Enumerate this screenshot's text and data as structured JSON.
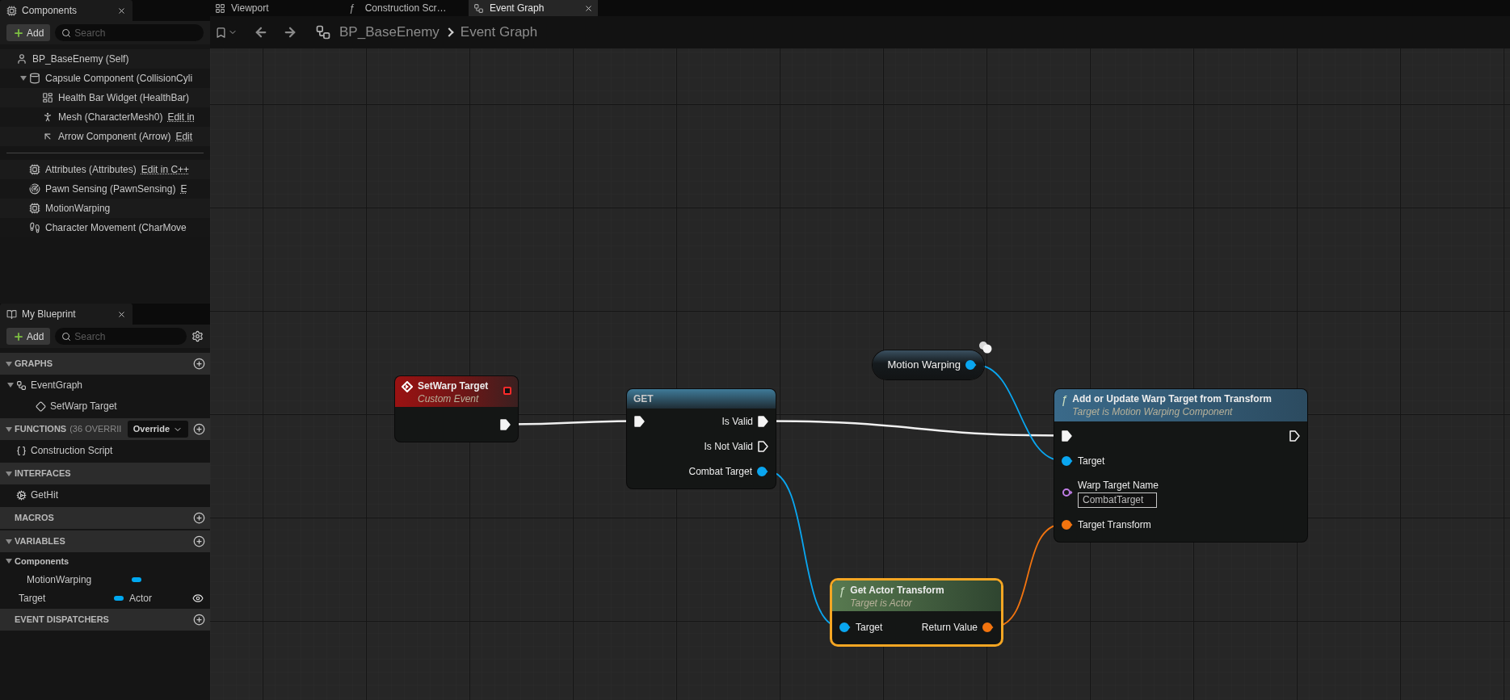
{
  "components_panel": {
    "tab": "Components",
    "add_label": "Add",
    "search_placeholder": "Search",
    "tree": [
      {
        "label": "BP_BaseEnemy (Self)",
        "children": [
          {
            "label": "Capsule Component (CollisionCyli",
            "expanded": true,
            "children": [
              {
                "label": "Health Bar Widget (HealthBar)"
              },
              {
                "label": "Mesh (CharacterMesh0)",
                "link": "Edit in"
              },
              {
                "label": "Arrow Component (Arrow)",
                "link": "Edit"
              }
            ]
          }
        ]
      }
    ],
    "native_components": [
      {
        "label": "Attributes (Attributes)",
        "link": "Edit in C++"
      },
      {
        "label": "Pawn Sensing (PawnSensing)",
        "link": "E"
      },
      {
        "label": "MotionWarping"
      },
      {
        "label": "Character Movement (CharMove"
      }
    ]
  },
  "my_blueprint": {
    "tab": "My Blueprint",
    "add_label": "Add",
    "search_placeholder": "Search",
    "sections": [
      {
        "kind": "graphs",
        "title": "GRAPHS",
        "expanded": true,
        "add": true,
        "items": [
          {
            "label": "EventGraph",
            "expanded": true,
            "children": [
              {
                "label": "SetWarp Target"
              }
            ]
          }
        ]
      },
      {
        "kind": "functions",
        "title": "FUNCTIONS",
        "note": "(36 OVERRII",
        "dropdown": "Override",
        "expanded": true,
        "add": true,
        "items": [
          {
            "label": "Construction Script"
          }
        ]
      },
      {
        "kind": "interfaces",
        "title": "INTERFACES",
        "expanded": true,
        "add": false,
        "items": [
          {
            "label": "GetHit"
          }
        ]
      },
      {
        "title": "MACROS",
        "add": true
      },
      {
        "title": "VARIABLES",
        "expanded": true,
        "add": true,
        "categories": [
          {
            "label": "Components",
            "expanded": true,
            "variables": [
              {
                "name": "MotionWarping"
              }
            ]
          }
        ],
        "variables": [
          {
            "name": "Target",
            "type": "Actor",
            "public": true
          }
        ]
      },
      {
        "title": "EVENT DISPATCHERS",
        "add": true
      }
    ]
  },
  "editor_tabs": [
    {
      "label": "Viewport",
      "selected": false
    },
    {
      "label": "Construction Scr…",
      "glyph": "ƒ",
      "selected": false
    },
    {
      "label": "Event Graph",
      "selected": true
    }
  ],
  "breadcrumb": [
    "BP_BaseEnemy",
    "Event Graph"
  ],
  "graph": {
    "nodes": [
      {
        "kind": "event",
        "title": "SetWarp Target",
        "subtitle": "Custom Event",
        "selected": false,
        "outputs": [
          {
            "kind": "exec",
            "connected": true
          }
        ]
      },
      {
        "kind": "macro",
        "title": "GET",
        "selected": false,
        "inputs": [
          {
            "kind": "exec",
            "connected": true
          }
        ],
        "outputs": [
          {
            "label": "Is Valid",
            "kind": "exec",
            "connected": true
          },
          {
            "label": "Is Not Valid",
            "kind": "exec",
            "connected": false
          },
          {
            "label": "Combat Target",
            "kind": "object",
            "connected": true
          }
        ]
      },
      {
        "kind": "variable",
        "title": "Motion Warping",
        "selected": false,
        "outputs": [
          {
            "kind": "object",
            "connected": true
          }
        ]
      },
      {
        "kind": "function",
        "glyph": "ƒ",
        "title": "Add or Update Warp Target from Transform",
        "subtitle": "Target is Motion Warping Component",
        "selected": false,
        "inputs": [
          {
            "kind": "exec",
            "connected": true
          },
          {
            "label": "Target",
            "kind": "object",
            "connected": true
          },
          {
            "label": "Warp Target Name",
            "kind": "name",
            "connected": false,
            "value": "CombatTarget"
          },
          {
            "label": "Target Transform",
            "kind": "transform",
            "connected": true
          }
        ],
        "outputs": [
          {
            "kind": "exec",
            "connected": false
          }
        ]
      },
      {
        "kind": "pure",
        "glyph": "ƒ",
        "title": "Get Actor Transform",
        "subtitle": "Target is Actor",
        "selected": true,
        "inputs": [
          {
            "label": "Target",
            "kind": "object",
            "connected": true
          }
        ],
        "outputs": [
          {
            "label": "Return Value",
            "kind": "transform",
            "connected": true
          }
        ]
      }
    ]
  }
}
